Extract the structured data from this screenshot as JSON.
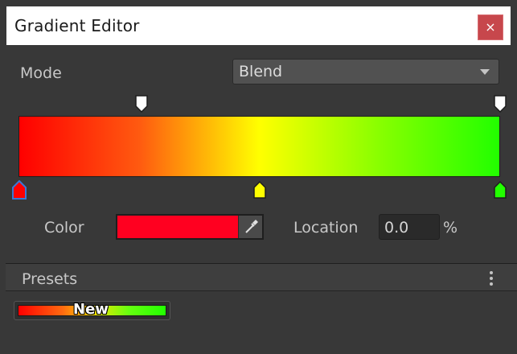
{
  "window": {
    "title": "Gradient Editor",
    "close_label": "×"
  },
  "mode": {
    "label": "Mode",
    "value": "Blend"
  },
  "alpha_keys": [
    {
      "location": 0.25,
      "color": "#ffffff"
    },
    {
      "location": 1.0,
      "color": "#ffffff"
    }
  ],
  "color_keys": [
    {
      "location": 0.0,
      "color": "#ff0000",
      "selected": true
    },
    {
      "location": 0.5,
      "color": "#ffff00",
      "selected": false
    },
    {
      "location": 1.0,
      "color": "#22ff00",
      "selected": false
    }
  ],
  "selected_key": {
    "color_label": "Color",
    "color_value": "#ff0020",
    "location_label": "Location",
    "location_value": "0.0",
    "location_unit": "%"
  },
  "presets": {
    "title": "Presets",
    "items": [
      {
        "name": "New"
      }
    ]
  },
  "colors": {
    "close_button": "#c7474c",
    "panel_bg": "#383838",
    "selection_outline": "#3a78d6"
  },
  "icons": {
    "close": "close-icon",
    "dropdown": "chevron-down-icon",
    "eyedropper": "eyedropper-icon",
    "menu": "kebab-menu-icon"
  }
}
